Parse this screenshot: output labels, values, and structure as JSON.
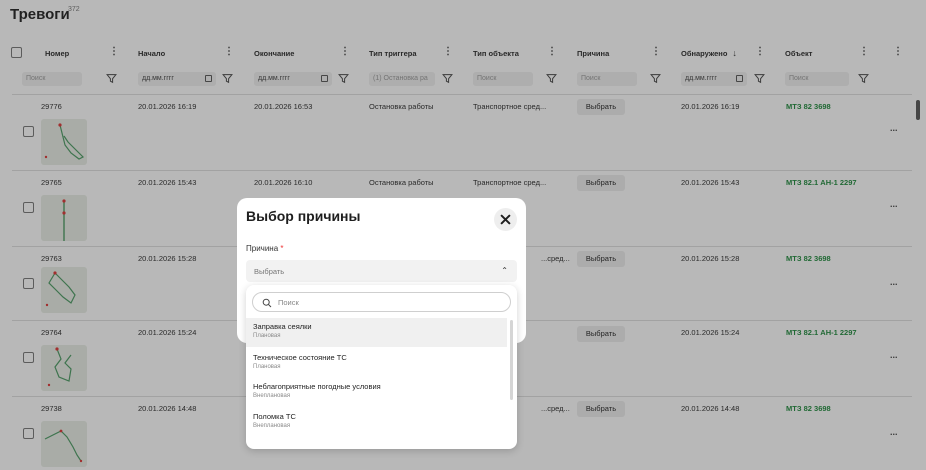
{
  "page": {
    "title": "Тревоги",
    "count": "372"
  },
  "table": {
    "columns": [
      {
        "label": "Номер"
      },
      {
        "label": "Начало"
      },
      {
        "label": "Окончание"
      },
      {
        "label": "Тип триггера"
      },
      {
        "label": "Тип объекта"
      },
      {
        "label": "Причина"
      },
      {
        "label": "Обнаружено"
      },
      {
        "label": "Объект"
      }
    ],
    "filters": {
      "number": "Поиск",
      "start": "дд.мм.гггг",
      "end": "дд.мм.гггг",
      "trigger": "(1) Остановка ра",
      "object_type": "Поиск",
      "reason": "Поиск",
      "detected": "дд.мм.гггг",
      "object": "Поиск"
    },
    "choose_label": "Выбрать",
    "more_glyph": "...",
    "rows": [
      {
        "number": "29776",
        "start": "20.01.2026 16:19",
        "end": "20.01.2026 16:53",
        "trigger": "Остановка работы",
        "object_type": "Транспортное сред...",
        "detected": "20.01.2026 16:19",
        "object": "МТЗ 82 3698"
      },
      {
        "number": "29765",
        "start": "20.01.2026 15:43",
        "end": "20.01.2026 16:10",
        "trigger": "Остановка работы",
        "object_type": "Транспортное сред...",
        "detected": "20.01.2026 15:43",
        "object": "МТЗ 82.1 АН-1 2297"
      },
      {
        "number": "29763",
        "start": "20.01.2026 15:28",
        "end": "",
        "trigger": "",
        "object_type": "...сред...",
        "detected": "20.01.2026 15:28",
        "object": "МТЗ 82 3698"
      },
      {
        "number": "29764",
        "start": "20.01.2026 15:24",
        "end": "",
        "trigger": "",
        "object_type": "",
        "detected": "20.01.2026 15:24",
        "object": "МТЗ 82.1 АН-1 2297"
      },
      {
        "number": "29738",
        "start": "20.01.2026 14:48",
        "end": "",
        "trigger": "",
        "object_type": "...сред...",
        "detected": "20.01.2026 14:48",
        "object": "МТЗ 82 3698"
      }
    ]
  },
  "modal": {
    "title": "Выбор причины",
    "field_label": "Причина",
    "required_mark": "*",
    "select_placeholder": "Выбрать",
    "search_placeholder": "Поиск",
    "options": [
      {
        "title": "Заправка сеялки",
        "type": "Плановая"
      },
      {
        "title": "Техническое состояние ТС",
        "type": "Плановая"
      },
      {
        "title": "Неблагоприятные погодные условия",
        "type": "Внеплановая"
      },
      {
        "title": "Поломка ТС",
        "type": "Внеплановая"
      }
    ]
  },
  "colors": {
    "accent_green": "#1f8a3c",
    "required_red": "#e33333"
  },
  "icons": [
    "sort-down-icon",
    "filter-icon",
    "calendar-icon",
    "kebab-icon",
    "close-icon",
    "chevron-up-icon",
    "search-icon",
    "more-icon"
  ]
}
